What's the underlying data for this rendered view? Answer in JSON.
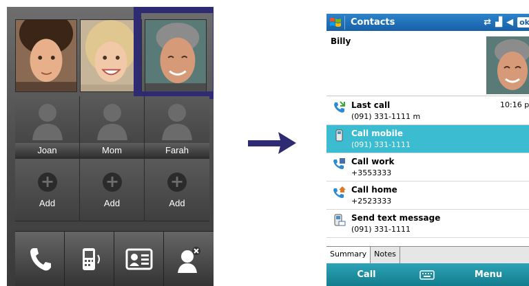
{
  "left": {
    "contacts": [
      {
        "name": "Joan"
      },
      {
        "name": "Mom"
      },
      {
        "name": "Farah"
      }
    ],
    "add_slots": [
      {
        "label": "Add"
      },
      {
        "label": "Add"
      },
      {
        "label": "Add"
      }
    ],
    "dock": [
      {
        "icon": "phone-handset-icon"
      },
      {
        "icon": "mobile-device-icon"
      },
      {
        "icon": "contact-card-icon"
      },
      {
        "icon": "remove-contact-icon"
      }
    ]
  },
  "arrow": {
    "icon": "right-arrow-icon",
    "color": "#2e2b72"
  },
  "phone": {
    "titlebar": {
      "title": "Contacts",
      "ok": "ok"
    },
    "contact": {
      "name": "Billy"
    },
    "actions": [
      {
        "title": "Last call",
        "sub": "(091) 331-1111 m",
        "time": "10:16 p",
        "icon": "incoming-call-icon"
      },
      {
        "title": "Call mobile",
        "sub": "(091) 331-1111",
        "icon": "mobile-phone-icon",
        "selected": true
      },
      {
        "title": "Call work",
        "sub": "+3553333",
        "icon": "work-phone-icon"
      },
      {
        "title": "Call home",
        "sub": "+2523333",
        "icon": "home-phone-icon"
      },
      {
        "title": "Send text message",
        "sub": "(091) 331-1111",
        "icon": "text-message-icon"
      }
    ],
    "tabs": [
      {
        "label": "Summary"
      },
      {
        "label": "Notes"
      }
    ],
    "softkeys": {
      "left": "Call",
      "right": "Menu"
    },
    "colors": {
      "titlebar": "#1760a8",
      "selected_row": "#3bbcd0",
      "softkey_bar": "#1e8fa1"
    }
  }
}
